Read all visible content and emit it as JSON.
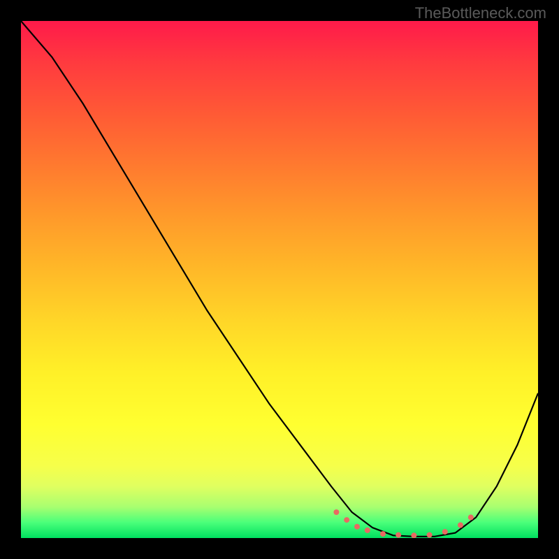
{
  "watermark": "TheBottleneck.com",
  "chart_data": {
    "type": "line",
    "title": "",
    "xlabel": "",
    "ylabel": "",
    "xlim": [
      0,
      100
    ],
    "ylim": [
      0,
      100
    ],
    "series": [
      {
        "name": "curve",
        "x": [
          0,
          6,
          12,
          18,
          24,
          30,
          36,
          42,
          48,
          54,
          60,
          64,
          68,
          72,
          76,
          80,
          84,
          88,
          92,
          96,
          100
        ],
        "values": [
          100,
          93,
          84,
          74,
          64,
          54,
          44,
          35,
          26,
          18,
          10,
          5,
          2,
          0.5,
          0.3,
          0.3,
          1,
          4,
          10,
          18,
          28
        ]
      }
    ],
    "markers": {
      "comment": "red dots clustered near the trough",
      "x": [
        61,
        63,
        65,
        67,
        70,
        73,
        76,
        79,
        82,
        85,
        87
      ],
      "y": [
        5,
        3.5,
        2.2,
        1.5,
        0.8,
        0.6,
        0.5,
        0.6,
        1.2,
        2.5,
        4
      ]
    },
    "background_gradient": {
      "top": "#ff1a4a",
      "bottom": "#00e060"
    }
  }
}
